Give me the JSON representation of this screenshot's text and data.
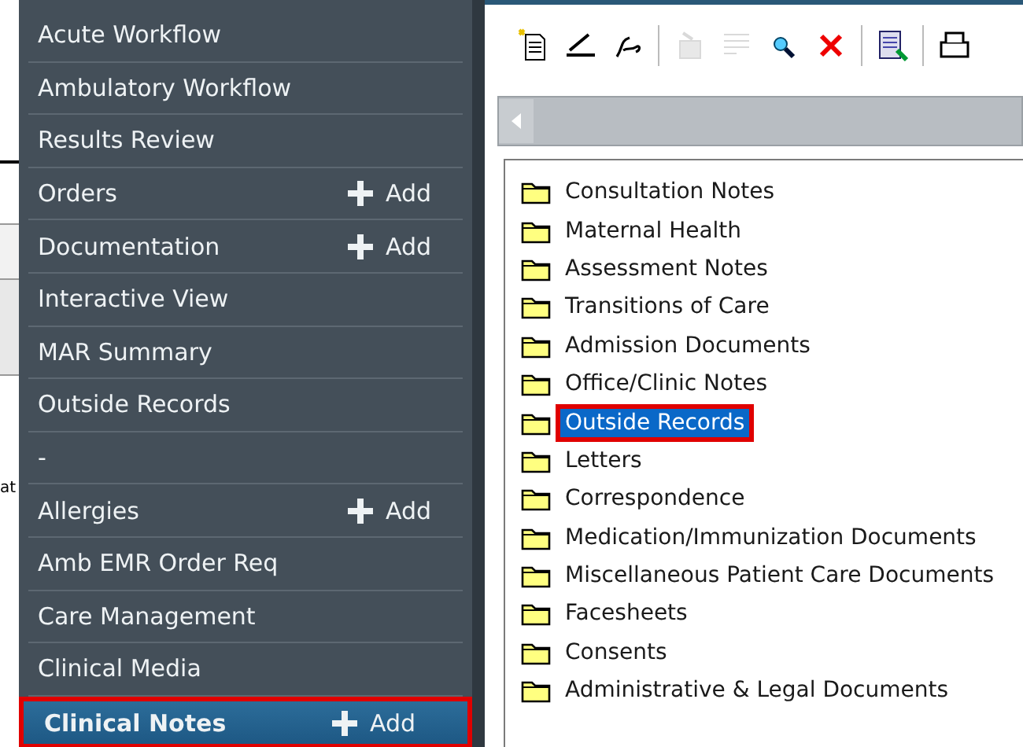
{
  "background": {
    "fragment": "at"
  },
  "sidebar": {
    "items": [
      {
        "label": "Acute Workflow",
        "add": false,
        "selected": false
      },
      {
        "label": "Ambulatory Workflow",
        "add": false,
        "selected": false
      },
      {
        "label": "Results Review",
        "add": false,
        "selected": false
      },
      {
        "label": "Orders",
        "add": "Add",
        "selected": false
      },
      {
        "label": "Documentation",
        "add": "Add",
        "selected": false
      },
      {
        "label": "Interactive View",
        "add": false,
        "selected": false
      },
      {
        "label": "MAR Summary",
        "add": false,
        "selected": false
      },
      {
        "label": "Outside Records",
        "add": false,
        "selected": false
      },
      {
        "label": "-",
        "add": false,
        "selected": false
      },
      {
        "label": "Allergies",
        "add": "Add",
        "selected": false
      },
      {
        "label": "Amb EMR Order Req",
        "add": false,
        "selected": false
      },
      {
        "label": "Care Management",
        "add": false,
        "selected": false
      },
      {
        "label": "Clinical Media",
        "add": false,
        "selected": false
      },
      {
        "label": "Clinical Notes",
        "add": "Add",
        "selected": true
      }
    ]
  },
  "toolbar": {
    "buttons": [
      {
        "kind": "new",
        "disabled": false
      },
      {
        "kind": "sign",
        "disabled": false
      },
      {
        "kind": "forward",
        "disabled": false
      },
      {
        "kind": "sep"
      },
      {
        "kind": "cabinet",
        "disabled": true
      },
      {
        "kind": "lines",
        "disabled": true
      },
      {
        "kind": "search",
        "disabled": false
      },
      {
        "kind": "delete",
        "disabled": false
      },
      {
        "kind": "sep"
      },
      {
        "kind": "report",
        "disabled": false
      },
      {
        "kind": "sep"
      },
      {
        "kind": "print",
        "disabled": false
      }
    ]
  },
  "folders": [
    {
      "label": "Consultation Notes",
      "selected": false
    },
    {
      "label": "Maternal Health",
      "selected": false
    },
    {
      "label": "Assessment Notes",
      "selected": false
    },
    {
      "label": "Transitions of Care",
      "selected": false
    },
    {
      "label": "Admission Documents",
      "selected": false
    },
    {
      "label": "Office/Clinic Notes",
      "selected": false
    },
    {
      "label": "Outside Records",
      "selected": true
    },
    {
      "label": "Letters",
      "selected": false
    },
    {
      "label": "Correspondence",
      "selected": false
    },
    {
      "label": "Medication/Immunization Documents",
      "selected": false
    },
    {
      "label": "Miscellaneous Patient Care Documents",
      "selected": false
    },
    {
      "label": "Facesheets",
      "selected": false
    },
    {
      "label": "Consents",
      "selected": false
    },
    {
      "label": "Administrative & Legal Documents",
      "selected": false
    }
  ]
}
